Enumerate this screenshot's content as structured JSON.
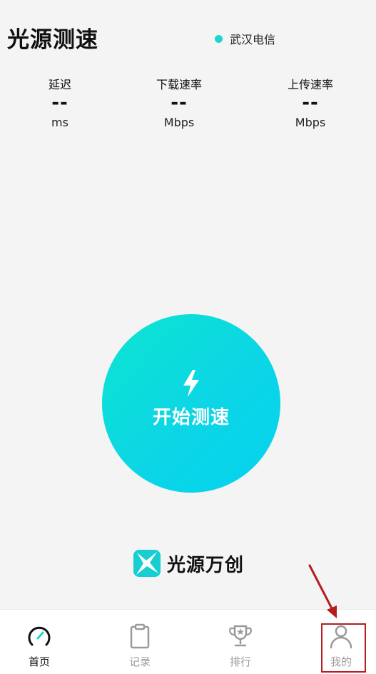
{
  "header": {
    "title": "光源测速",
    "isp_label": "武汉电信",
    "isp_dot_color": "#1ed6cf"
  },
  "metrics": [
    {
      "label": "延迟",
      "value": "--",
      "unit": "ms"
    },
    {
      "label": "下载速率",
      "value": "--",
      "unit": "Mbps"
    },
    {
      "label": "上传速率",
      "value": "--",
      "unit": "Mbps"
    }
  ],
  "start_button": {
    "label": "开始测速",
    "icon": "lightning-bolt-icon",
    "gradient_start": "#0de4cf",
    "gradient_end": "#04d3ef"
  },
  "brand": {
    "name": "光源万创",
    "logo_icon": "starburst-logo"
  },
  "tabbar": {
    "active_color": "#111111",
    "inactive_color": "#9a9a9a",
    "items": [
      {
        "label": "首页",
        "icon": "speedometer-icon",
        "active": true
      },
      {
        "label": "记录",
        "icon": "clipboard-icon",
        "active": false
      },
      {
        "label": "排行",
        "icon": "trophy-icon",
        "active": false
      },
      {
        "label": "我的",
        "icon": "person-icon",
        "active": false
      }
    ]
  },
  "annotation": {
    "color": "#b51e1e",
    "target": "tab-mine"
  }
}
